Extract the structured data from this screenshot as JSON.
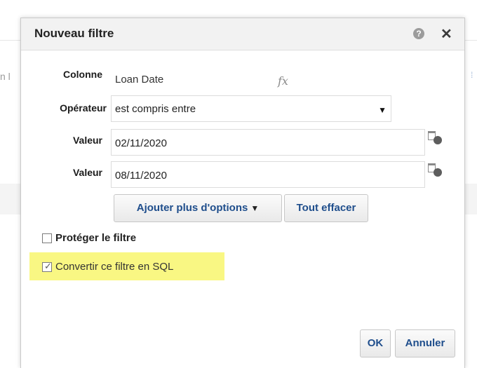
{
  "background": {
    "partial_label": "n l"
  },
  "dialog": {
    "title": "Nouveau filtre",
    "help_glyph": "?",
    "close_glyph": "✕",
    "icons": {
      "help": "help-icon",
      "close": "close-icon",
      "calendar": "calendar-clock-icon",
      "fx": "fx-icon"
    },
    "column": {
      "label": "Colonne",
      "value": "Loan Date",
      "fx_glyph": "fx"
    },
    "operator": {
      "label": "Opérateur",
      "value": "est compris entre",
      "arrow": "▼"
    },
    "value1": {
      "label": "Valeur",
      "value": "02/11/2020"
    },
    "value2": {
      "label": "Valeur",
      "value": "08/11/2020"
    },
    "add_options_label": "Ajouter plus d'options",
    "add_options_arrow": "▼",
    "clear_all_label": "Tout effacer",
    "protect_filter": {
      "label": "Protéger le filtre",
      "checked": false
    },
    "convert_sql": {
      "label": "Convertir ce filtre en SQL",
      "checked": true,
      "check_glyph": "✓",
      "highlight_color": "#f9f783"
    },
    "ok_label": "OK",
    "cancel_label": "Annuler"
  }
}
